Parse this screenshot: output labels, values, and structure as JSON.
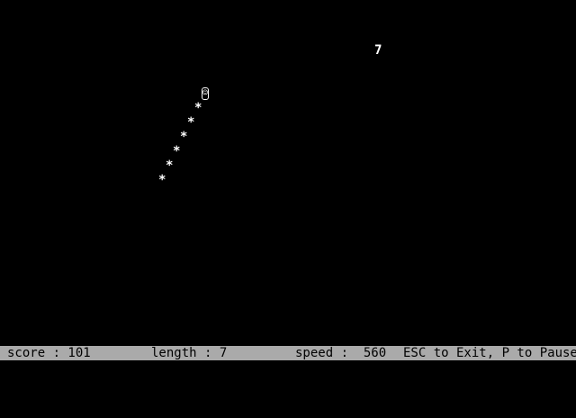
{
  "game": {
    "food": {
      "glyph": "7",
      "col": 52,
      "row": 3
    },
    "snake": {
      "head_glyph": "☺",
      "body_glyph": "*",
      "cells": [
        {
          "col": 28,
          "row": 6
        },
        {
          "col": 27,
          "row": 7
        },
        {
          "col": 26,
          "row": 8
        },
        {
          "col": 25,
          "row": 9
        },
        {
          "col": 24,
          "row": 10
        },
        {
          "col": 23,
          "row": 11
        },
        {
          "col": 22,
          "row": 12
        }
      ]
    }
  },
  "status": {
    "score_label": "score : 101",
    "length_label": "length : 7",
    "speed_label": "speed :  560",
    "help_label": "ESC to Exit, P to Pause"
  },
  "colors": {
    "background": "#000000",
    "foreground": "#ffffff",
    "status_bar": "#aaaaaa",
    "status_text": "#000000"
  }
}
